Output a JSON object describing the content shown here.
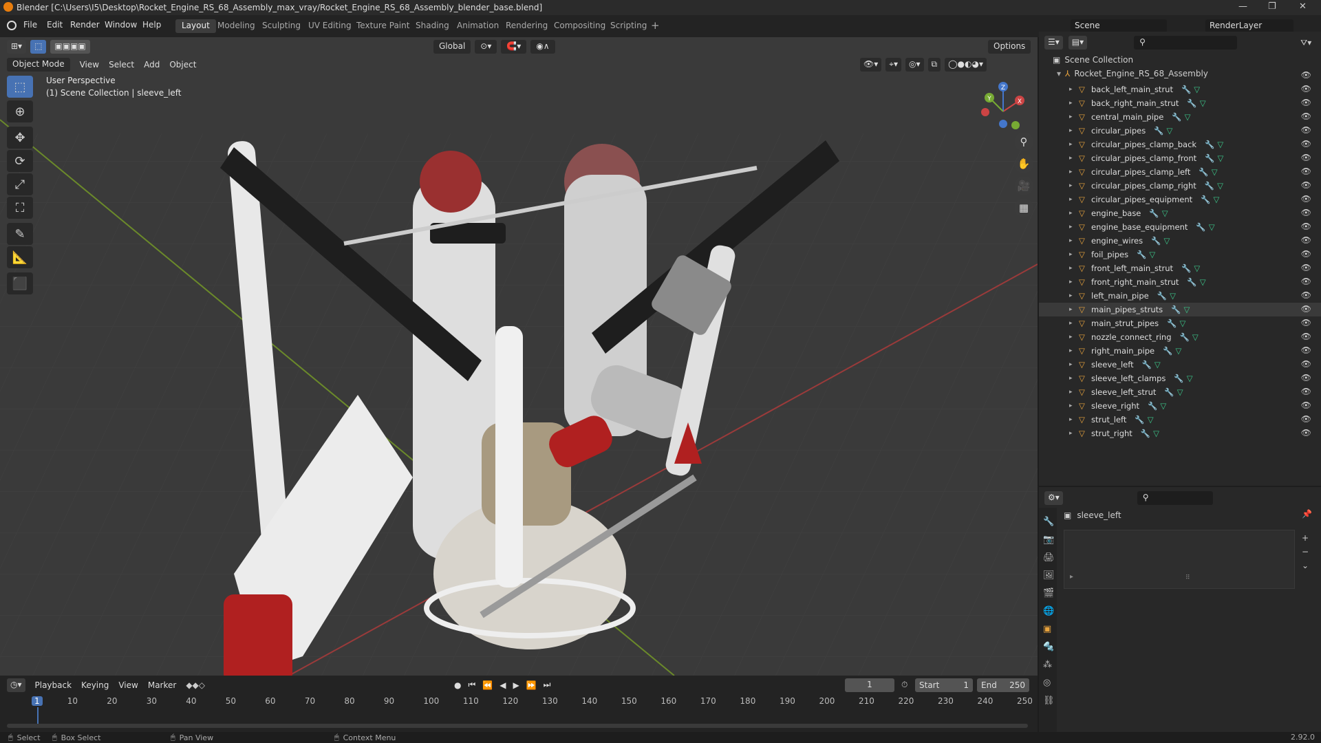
{
  "window": {
    "title": "Blender [C:\\Users\\I5\\Desktop\\Rocket_Engine_RS_68_Assembly_max_vray/Rocket_Engine_RS_68_Assembly_blender_base.blend]",
    "app_icon": "blender-logo-icon",
    "min": "—",
    "max": "❐",
    "close": "✕"
  },
  "menus": [
    "File",
    "Edit",
    "Render",
    "Window",
    "Help"
  ],
  "workspaces": [
    "Layout",
    "Modeling",
    "Sculpting",
    "UV Editing",
    "Texture Paint",
    "Shading",
    "Animation",
    "Rendering",
    "Compositing",
    "Scripting"
  ],
  "scene": {
    "label": "Scene",
    "renderlayer": "RenderLayer"
  },
  "viewport": {
    "transform": "Global",
    "options": "Options",
    "mode": "Object Mode",
    "menu": [
      "View",
      "Select",
      "Add",
      "Object"
    ],
    "perspective": "User Perspective",
    "collection_info": "(1) Scene Collection | sleeve_left",
    "gizmo": {
      "x": "X",
      "y": "Y",
      "z": "Z"
    },
    "tools": [
      "select-box-icon",
      "cursor-icon",
      "move-icon",
      "rotate-icon",
      "scale-icon",
      "transform-icon",
      "annotate-icon",
      "measure-icon",
      "add-cube-icon"
    ],
    "colors": {
      "bg": "#3a3a3a",
      "x_axis": "#9b3a3a",
      "y_axis": "#6b8a2a",
      "active": "#4772b3"
    }
  },
  "outliner": {
    "root": "Scene Collection",
    "collection": "Rocket_Engine_RS_68_Assembly",
    "items": [
      "back_left_main_strut",
      "back_right_main_strut",
      "central_main_pipe",
      "circular_pipes",
      "circular_pipes_clamp_back",
      "circular_pipes_clamp_front",
      "circular_pipes_clamp_left",
      "circular_pipes_clamp_right",
      "circular_pipes_equipment",
      "engine_base",
      "engine_base_equipment",
      "engine_wires",
      "foil_pipes",
      "front_left_main_strut",
      "front_right_main_strut",
      "left_main_pipe",
      "main_pipes_struts",
      "main_strut_pipes",
      "nozzle_connect_ring",
      "right_main_pipe",
      "sleeve_left",
      "sleeve_left_clamps",
      "sleeve_left_strut",
      "sleeve_right",
      "strut_left",
      "strut_right"
    ],
    "highlighted": "main_pipes_struts",
    "selected": "sleeve_left"
  },
  "properties": {
    "object": "sleeve_left"
  },
  "timeline": {
    "menus": [
      "Playback",
      "Keying",
      "View",
      "Marker"
    ],
    "current": "1",
    "start_label": "Start",
    "start": "1",
    "end_label": "End",
    "end": "250",
    "ticks": [
      "1",
      "10",
      "20",
      "30",
      "40",
      "50",
      "60",
      "70",
      "80",
      "90",
      "100",
      "110",
      "120",
      "130",
      "140",
      "150",
      "160",
      "170",
      "180",
      "190",
      "200",
      "210",
      "220",
      "230",
      "240",
      "250"
    ]
  },
  "status": {
    "select": "Select",
    "box_select": "Box Select",
    "pan": "Pan View",
    "context": "Context Menu",
    "version": "2.92.0"
  }
}
